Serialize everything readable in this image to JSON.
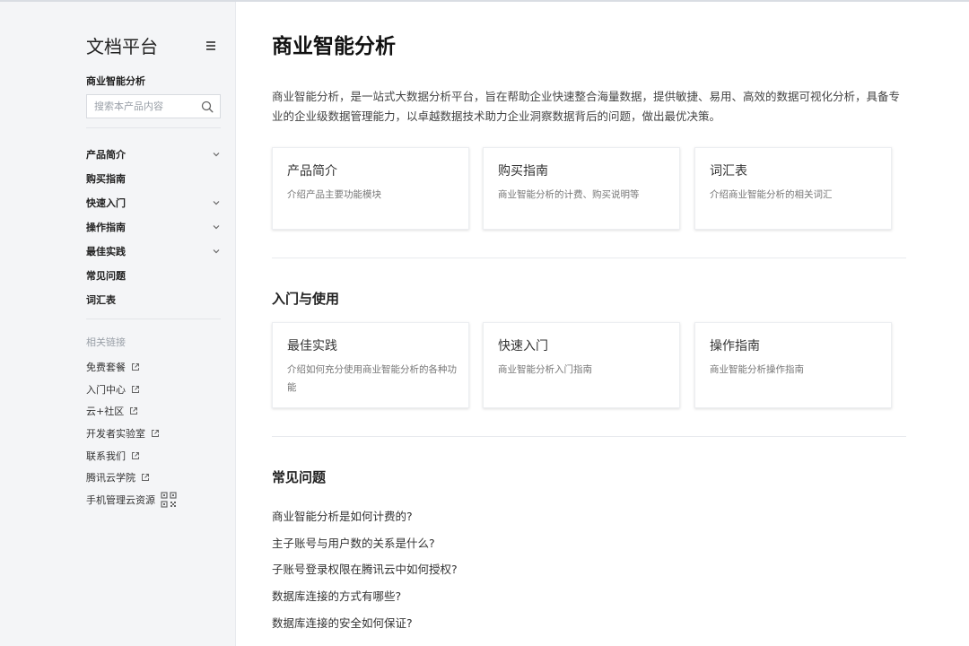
{
  "sidebar": {
    "title": "文档平台",
    "product_name": "商业智能分析",
    "search_placeholder": "搜索本产品内容",
    "nav": [
      {
        "label": "产品简介",
        "expandable": true
      },
      {
        "label": "购买指南",
        "expandable": false
      },
      {
        "label": "快速入门",
        "expandable": true
      },
      {
        "label": "操作指南",
        "expandable": true
      },
      {
        "label": "最佳实践",
        "expandable": true
      },
      {
        "label": "常见问题",
        "expandable": false
      },
      {
        "label": "词汇表",
        "expandable": false
      }
    ],
    "related_title": "相关链接",
    "related_links": [
      {
        "label": "免费套餐",
        "icon": "external-link-icon"
      },
      {
        "label": "入门中心",
        "icon": "external-link-icon"
      },
      {
        "label": "云+社区",
        "icon": "external-link-icon"
      },
      {
        "label": "开发者实验室",
        "icon": "external-link-icon"
      },
      {
        "label": "联系我们",
        "icon": "external-link-icon"
      },
      {
        "label": "腾讯云学院",
        "icon": "external-link-icon"
      },
      {
        "label": "手机管理云资源",
        "icon": "qr-code-icon"
      }
    ]
  },
  "main": {
    "title": "商业智能分析",
    "intro": "商业智能分析，是一站式大数据分析平台，旨在帮助企业快速整合海量数据，提供敏捷、易用、高效的数据可视化分析，具备专业的企业级数据管理能力，以卓越数据技术助力企业洞察数据背后的问题，做出最优决策。",
    "top_cards": [
      {
        "title": "产品简介",
        "desc": "介绍产品主要功能模块"
      },
      {
        "title": "购买指南",
        "desc": "商业智能分析的计费、购买说明等"
      },
      {
        "title": "词汇表",
        "desc": "介绍商业智能分析的相关词汇"
      }
    ],
    "section_getting_started": {
      "title": "入门与使用",
      "cards": [
        {
          "title": "最佳实践",
          "desc": "介绍如何充分使用商业智能分析的各种功能"
        },
        {
          "title": "快速入门",
          "desc": "商业智能分析入门指南"
        },
        {
          "title": "操作指南",
          "desc": "商业智能分析操作指南"
        }
      ]
    },
    "section_faq": {
      "title": "常见问题",
      "items": [
        "商业智能分析是如何计费的?",
        "主子账号与用户数的关系是什么?",
        "子账号登录权限在腾讯云中如何授权?",
        "数据库连接的方式有哪些?",
        "数据库连接的安全如何保证?"
      ]
    }
  }
}
